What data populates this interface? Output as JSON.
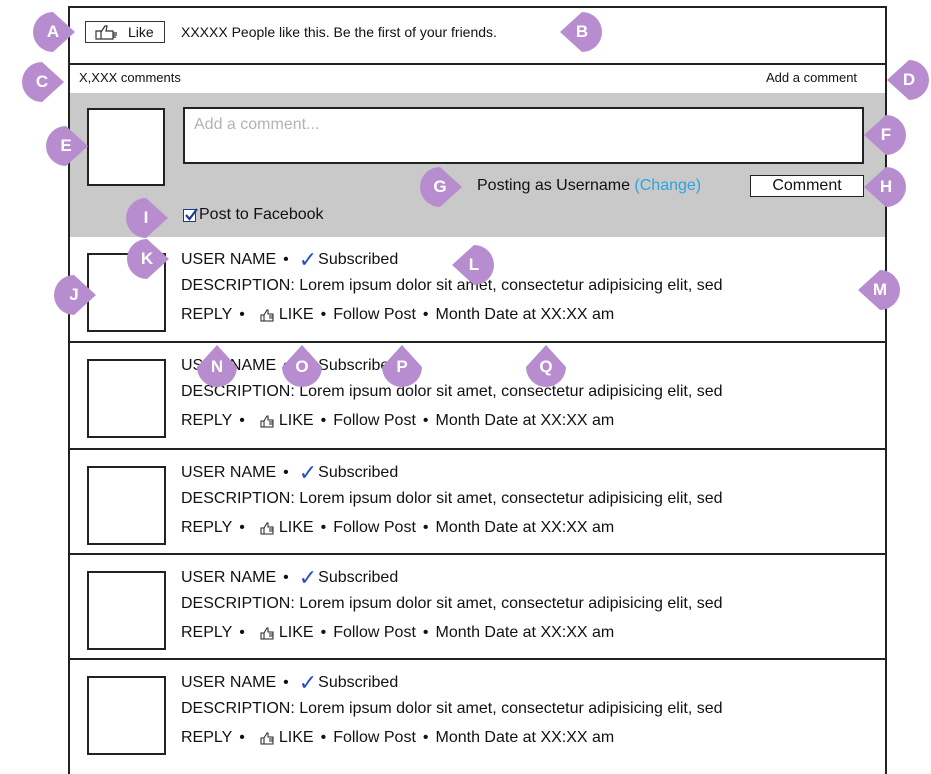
{
  "widget": {
    "like_button_label": "Like",
    "like_text": "XXXXX People like this. Be the first of your friends.",
    "comment_count": "X,XXX comments",
    "add_comment_link": "Add a comment"
  },
  "composer": {
    "placeholder": "Add a comment...",
    "posting_as": "Posting as Username",
    "change_link": "(Change)",
    "submit_label": "Comment",
    "post_to_facebook_label": "Post to Facebook",
    "post_to_facebook_checked": true
  },
  "comments": [
    {
      "user": "USER NAME",
      "sep": "•",
      "subscribed": "Subscribed",
      "description": "DESCRIPTION: Lorem ipsum dolor sit amet, consectetur adipisicing elit, sed",
      "reply": "REPLY",
      "like": "LIKE",
      "follow": "Follow Post",
      "date": "Month Date at XX:XX am"
    },
    {
      "user": "USER NAME",
      "sep": "•",
      "subscribed": "Subscribed",
      "description": "DESCRIPTION: Lorem ipsum dolor sit amet, consectetur adipisicing elit, sed",
      "reply": "REPLY",
      "like": "LIKE",
      "follow": "Follow Post",
      "date": "Month Date at XX:XX am"
    },
    {
      "user": "USER NAME",
      "sep": "•",
      "subscribed": "Subscribed",
      "description": "DESCRIPTION: Lorem ipsum dolor sit amet, consectetur adipisicing elit, sed",
      "reply": "REPLY",
      "like": "LIKE",
      "follow": "Follow Post",
      "date": "Month Date at XX:XX am"
    },
    {
      "user": "USER NAME",
      "sep": "•",
      "subscribed": "Subscribed",
      "description": "DESCRIPTION: Lorem ipsum dolor sit amet, consectetur adipisicing elit, sed",
      "reply": "REPLY",
      "like": "LIKE",
      "follow": "Follow Post",
      "date": "Month Date at XX:XX am"
    },
    {
      "user": "USER NAME",
      "sep": "•",
      "subscribed": "Subscribed",
      "description": "DESCRIPTION: Lorem ipsum dolor sit amet, consectetur adipisicing elit, sed",
      "reply": "REPLY",
      "like": "LIKE",
      "follow": "Follow Post",
      "date": "Month Date at XX:XX am"
    }
  ],
  "annotations": {
    "A": "A",
    "B": "B",
    "C": "C",
    "D": "D",
    "E": "E",
    "F": "F",
    "G": "G",
    "H": "H",
    "I": "I",
    "J": "J",
    "K": "K",
    "L": "L",
    "M": "M",
    "N": "N",
    "O": "O",
    "P": "P",
    "Q": "Q"
  },
  "colors": {
    "marker": "#b88dd0",
    "composer_bg": "#c9c9c9",
    "change_link": "#2ba4e0",
    "checkmark": "#2451c7"
  }
}
